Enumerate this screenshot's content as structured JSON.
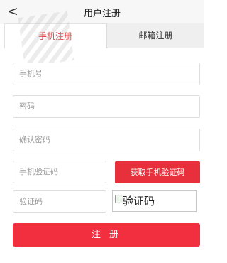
{
  "header": {
    "title": "用户注册",
    "back_icon": "chevron-left-icon",
    "back_glyph": "<"
  },
  "tabs": [
    {
      "label": "手机注册",
      "active": true
    },
    {
      "label": "邮箱注册",
      "active": false
    }
  ],
  "form": {
    "phone_placeholder": "手机号",
    "password_placeholder": "密码",
    "confirm_placeholder": "确认密码",
    "sms_code_placeholder": "手机验证码",
    "sms_button_label": "获取手机验证码",
    "captcha_placeholder": "验证码",
    "captcha_image_alt": "验证码",
    "submit_label": "注 册"
  },
  "colors": {
    "accent": "#e8303c",
    "submit": "#f12f3f",
    "active_tab_text": "#e43a3a"
  }
}
